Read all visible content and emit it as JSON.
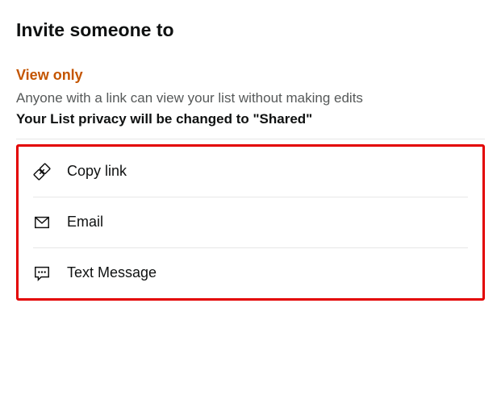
{
  "header": {
    "title": "Invite someone to"
  },
  "section": {
    "subtitle": "View only",
    "description": "Anyone with a link can view your list without making edits",
    "privacy_note": "Your List privacy will be changed to \"Shared\""
  },
  "options": [
    {
      "label": "Copy link"
    },
    {
      "label": "Email"
    },
    {
      "label": "Text Message"
    }
  ]
}
